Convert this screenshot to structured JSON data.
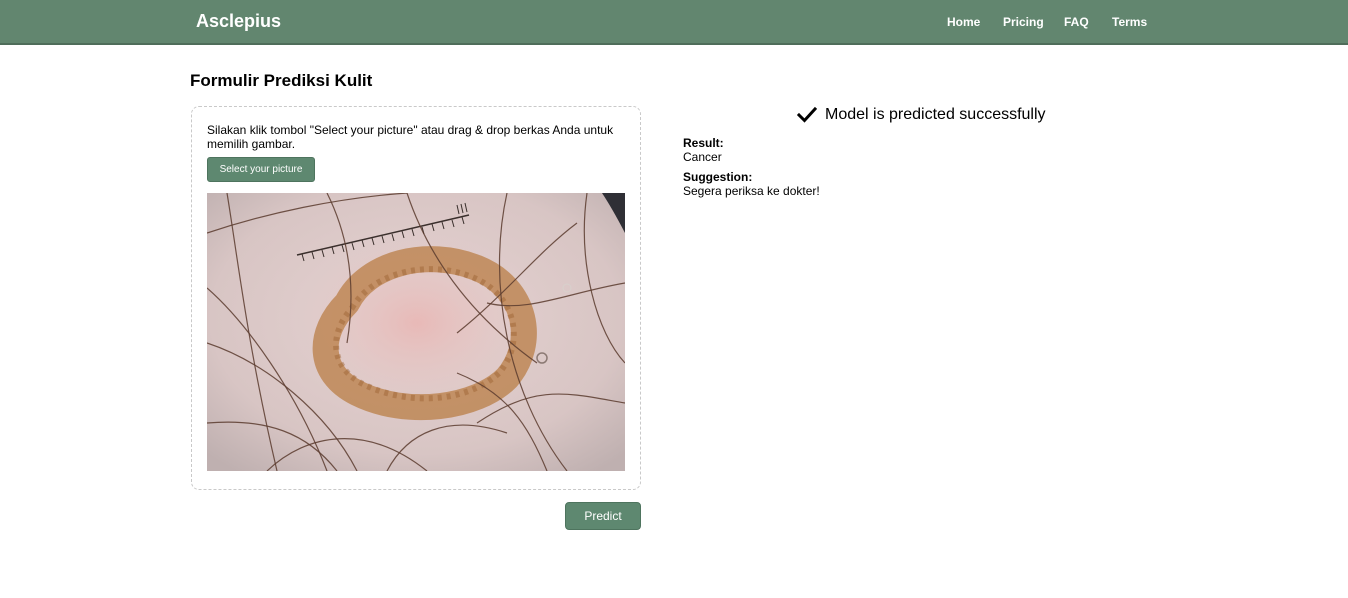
{
  "nav": {
    "brand": "Asclepius",
    "links": [
      "Home",
      "Pricing",
      "FAQ",
      "Terms"
    ]
  },
  "form": {
    "title": "Formulir Prediksi Kulit",
    "instructions": "Silakan klik tombol \"Select your picture\" atau drag & drop berkas Anda untuk memilih gambar.",
    "select_button": "Select your picture",
    "predict_button": "Predict"
  },
  "result": {
    "status": "Model is predicted successfully",
    "result_label": "Result:",
    "result_value": "Cancer",
    "suggestion_label": "Suggestion:",
    "suggestion_value": "Segera periksa ke dokter!"
  },
  "icons": {
    "status": "check-icon"
  },
  "colors": {
    "navbar": "#62866f",
    "button": "#5e8870"
  }
}
